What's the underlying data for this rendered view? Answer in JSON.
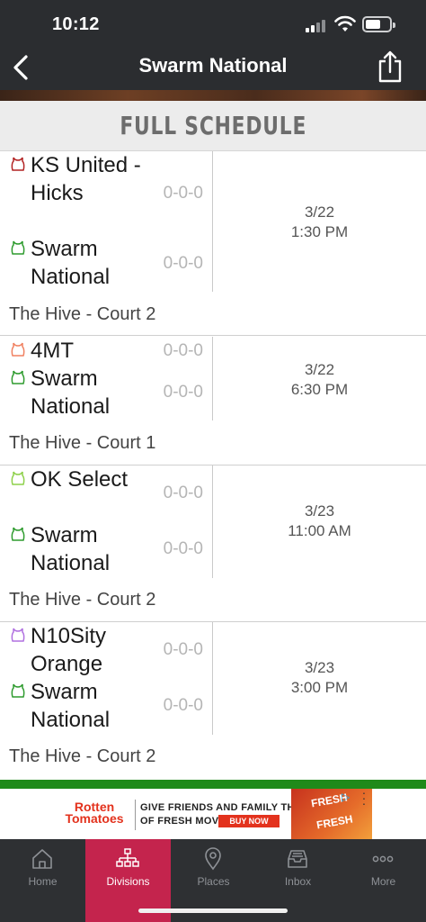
{
  "status_bar": {
    "time": "10:12"
  },
  "nav": {
    "title": "Swarm National"
  },
  "schedule": {
    "header": "FULL SCHEDULE",
    "games": [
      {
        "home": {
          "name": "KS United -Hicks",
          "record": "0-0-0",
          "icon_color": "#b22222"
        },
        "away": {
          "name": "Swarm National",
          "record": "0-0-0",
          "icon_color": "#2e9b2e"
        },
        "date": "3/22",
        "time": "1:30 PM",
        "venue": "The Hive - Court 2"
      },
      {
        "home": {
          "name": "4MT",
          "record": "0-0-0",
          "icon_color": "#f08060"
        },
        "away": {
          "name": "Swarm National",
          "record": "0-0-0",
          "icon_color": "#2e9b2e"
        },
        "date": "3/22",
        "time": "6:30 PM",
        "venue": "The Hive - Court 1"
      },
      {
        "home": {
          "name": "OK Select",
          "record": "0-0-0",
          "icon_color": "#8ed04a"
        },
        "away": {
          "name": "Swarm National",
          "record": "0-0-0",
          "icon_color": "#2e9b2e"
        },
        "date": "3/23",
        "time": "11:00 AM",
        "venue": "The Hive - Court 2"
      },
      {
        "home": {
          "name": "N10Sity Orange",
          "record": "0-0-0",
          "icon_color": "#b070e0"
        },
        "away": {
          "name": "Swarm National",
          "record": "0-0-0",
          "icon_color": "#2e9b2e"
        },
        "date": "3/23",
        "time": "3:00 PM",
        "venue": "The Hive - Court 2"
      }
    ]
  },
  "ad": {
    "logo": "Rotten Tomatoes",
    "line1": "GIVE FRIENDS AND FAMILY THE GIFT",
    "line2": "OF FRESH MOVIES",
    "button": "BUY NOW",
    "art_text": "FRESH"
  },
  "tabs": [
    {
      "label": "Home",
      "icon": "home-icon"
    },
    {
      "label": "Divisions",
      "icon": "org-chart-icon",
      "active": true
    },
    {
      "label": "Places",
      "icon": "map-pin-icon"
    },
    {
      "label": "Inbox",
      "icon": "inbox-icon"
    },
    {
      "label": "More",
      "icon": "more-dots-icon"
    }
  ],
  "colors": {
    "nav_bg": "#2b2d30",
    "active_tab": "#c4244d",
    "green_bar": "#1f8a1a"
  }
}
